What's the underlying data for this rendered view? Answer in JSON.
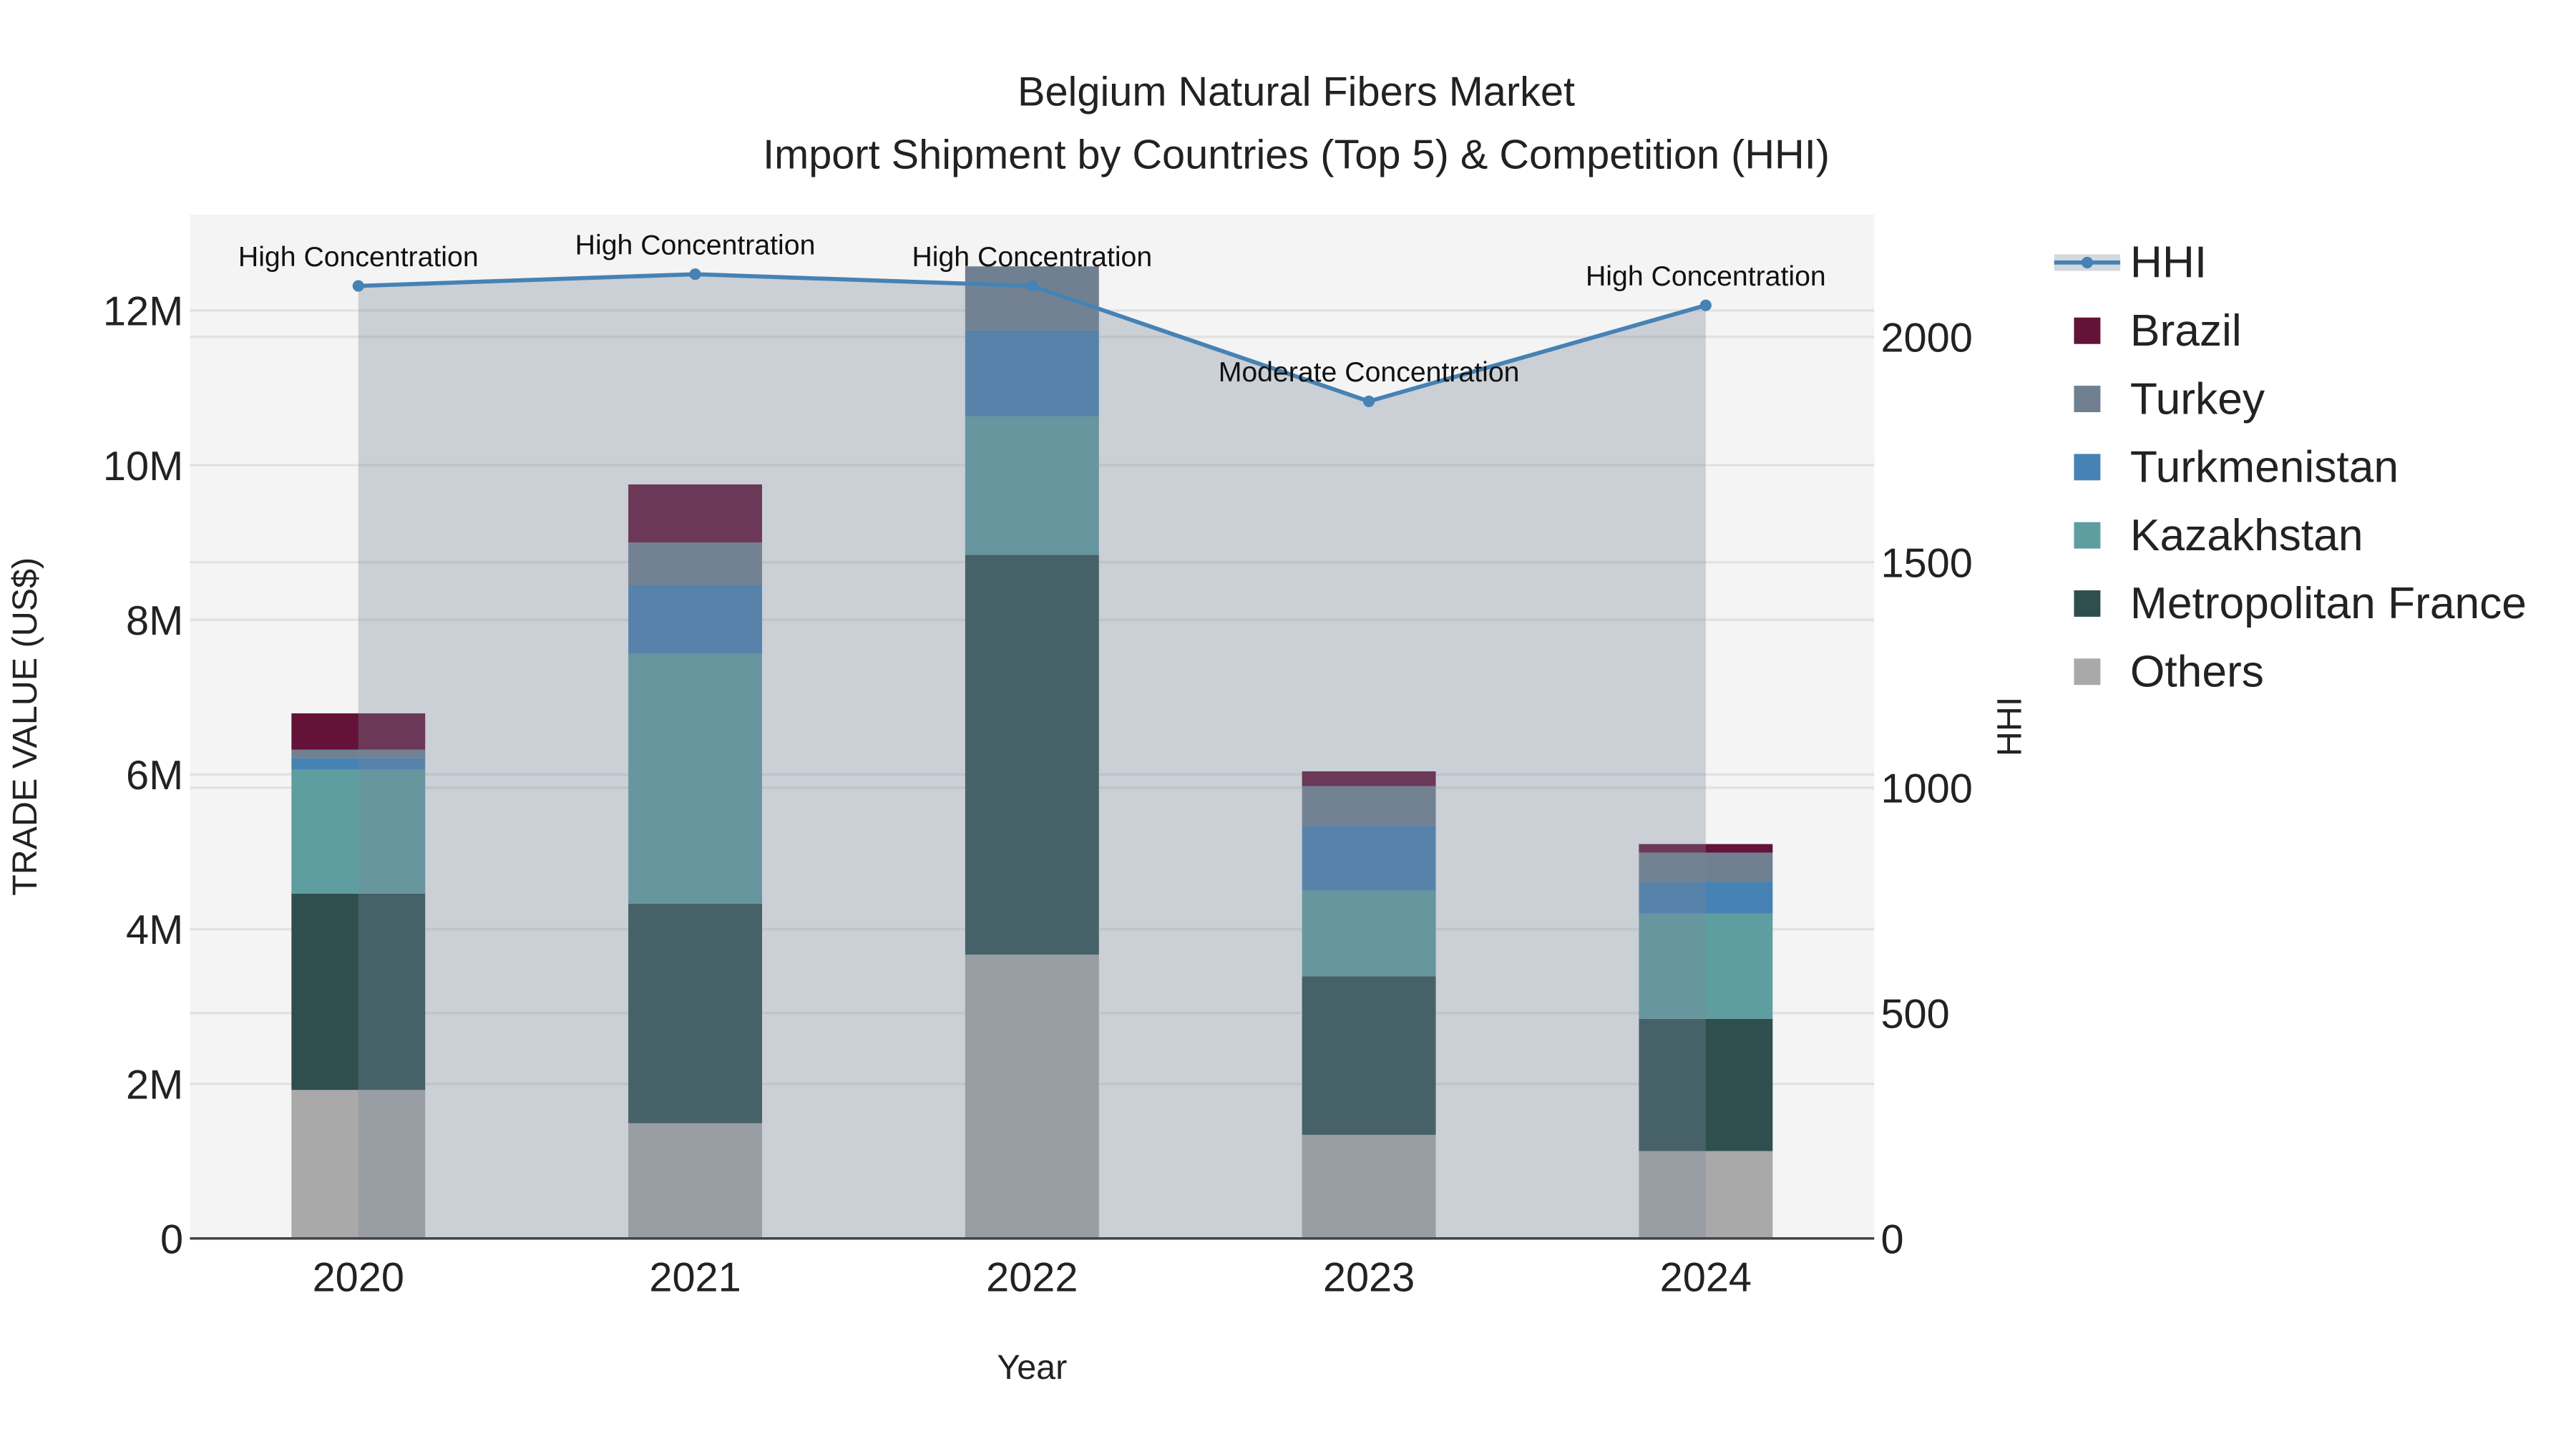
{
  "chart_data": {
    "type": "bar",
    "title": "Belgium Natural Fibers Market",
    "subtitle": "Import Shipment by Countries (Top 5) & Competition (HHI)",
    "xlabel": "Year",
    "ylabel": "TRADE VALUE (US$)",
    "y2label": "HHI",
    "categories": [
      "2020",
      "2021",
      "2022",
      "2023",
      "2024"
    ],
    "ylim": [
      0,
      13100000
    ],
    "y_ticks": [
      0,
      2000000,
      4000000,
      6000000,
      8000000,
      10000000,
      12000000
    ],
    "y_tick_labels": [
      "0",
      "2M",
      "4M",
      "6M",
      "8M",
      "10M",
      "12M"
    ],
    "y2lim": [
      0,
      2270
    ],
    "y2_ticks": [
      0,
      500,
      1000,
      1500,
      2000
    ],
    "y2_tick_labels": [
      "0",
      "500",
      "1000",
      "1500",
      "2000"
    ],
    "stacked": true,
    "series": [
      {
        "name": "Others",
        "color": "#a9a9a9",
        "values": [
          1920000,
          1490000,
          3670000,
          1340000,
          1130000
        ]
      },
      {
        "name": "Metropolitan France",
        "color": "#2f4f4f",
        "values": [
          2540000,
          2840000,
          5170000,
          2050000,
          1710000
        ]
      },
      {
        "name": "Kazakhstan",
        "color": "#5f9ea0",
        "values": [
          1600000,
          3230000,
          1790000,
          1110000,
          1360000
        ]
      },
      {
        "name": "Turkmenistan",
        "color": "#4682b4",
        "values": [
          150000,
          890000,
          1110000,
          840000,
          410000
        ]
      },
      {
        "name": "Turkey",
        "color": "#708090",
        "values": [
          110000,
          550000,
          830000,
          510000,
          380000
        ]
      },
      {
        "name": "Brazil",
        "color": "#641238",
        "values": [
          470000,
          750000,
          0,
          190000,
          110000
        ]
      }
    ],
    "hhi": {
      "name": "HHI",
      "color": "#4682b4",
      "values": [
        2113,
        2139,
        2113,
        1857,
        2070
      ],
      "annotations": [
        "High Concentration",
        "High Concentration",
        "High Concentration",
        "Moderate Concentration",
        "High Concentration"
      ]
    },
    "legend": {
      "placement": "right",
      "entries": [
        "HHI",
        "Brazil",
        "Turkey",
        "Turkmenistan",
        "Kazakhstan",
        "Metropolitan France",
        "Others"
      ]
    },
    "grid": true
  }
}
